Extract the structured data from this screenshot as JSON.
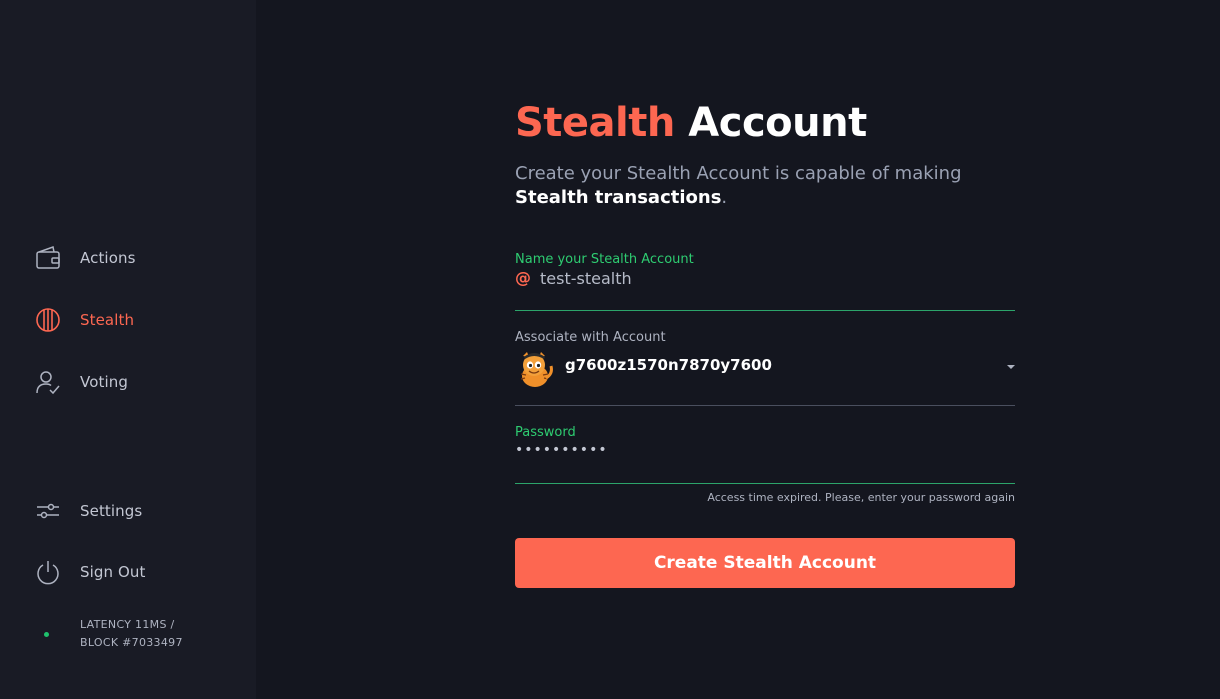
{
  "sidebar": {
    "nav": [
      {
        "label": "Actions",
        "icon": "wallet-icon"
      },
      {
        "label": "Stealth",
        "icon": "stealth-icon",
        "active": true
      },
      {
        "label": "Voting",
        "icon": "voter-check-icon"
      }
    ],
    "bottom": [
      {
        "label": "Settings",
        "icon": "sliders-icon"
      },
      {
        "label": "Sign Out",
        "icon": "power-icon"
      }
    ],
    "status": {
      "line1": "LATENCY 11MS /",
      "line2": "BLOCK #7033497",
      "color": "#1fc26d"
    }
  },
  "main": {
    "title_accent": "Stealth",
    "title_rest": " Account",
    "subtitle_plain": "Create your Stealth Account is capable of making ",
    "subtitle_strong": "Stealth transactions",
    "subtitle_end": ".",
    "name_field": {
      "label": "Name your Stealth Account",
      "prefix": "@",
      "value": "test-stealth"
    },
    "account_field": {
      "label": "Associate with Account",
      "value": "g7600z1570n7870y7600",
      "avatar_icon": "tiger-avatar-icon"
    },
    "password_field": {
      "label": "Password",
      "value": "••••••••••"
    },
    "hint": "Access time expired. Please, enter your password again",
    "submit_label": "Create Stealth Account"
  },
  "colors": {
    "accent": "#fd6751",
    "success": "#2ecc71",
    "background": "#14161f",
    "sidebar": "#191b25"
  }
}
